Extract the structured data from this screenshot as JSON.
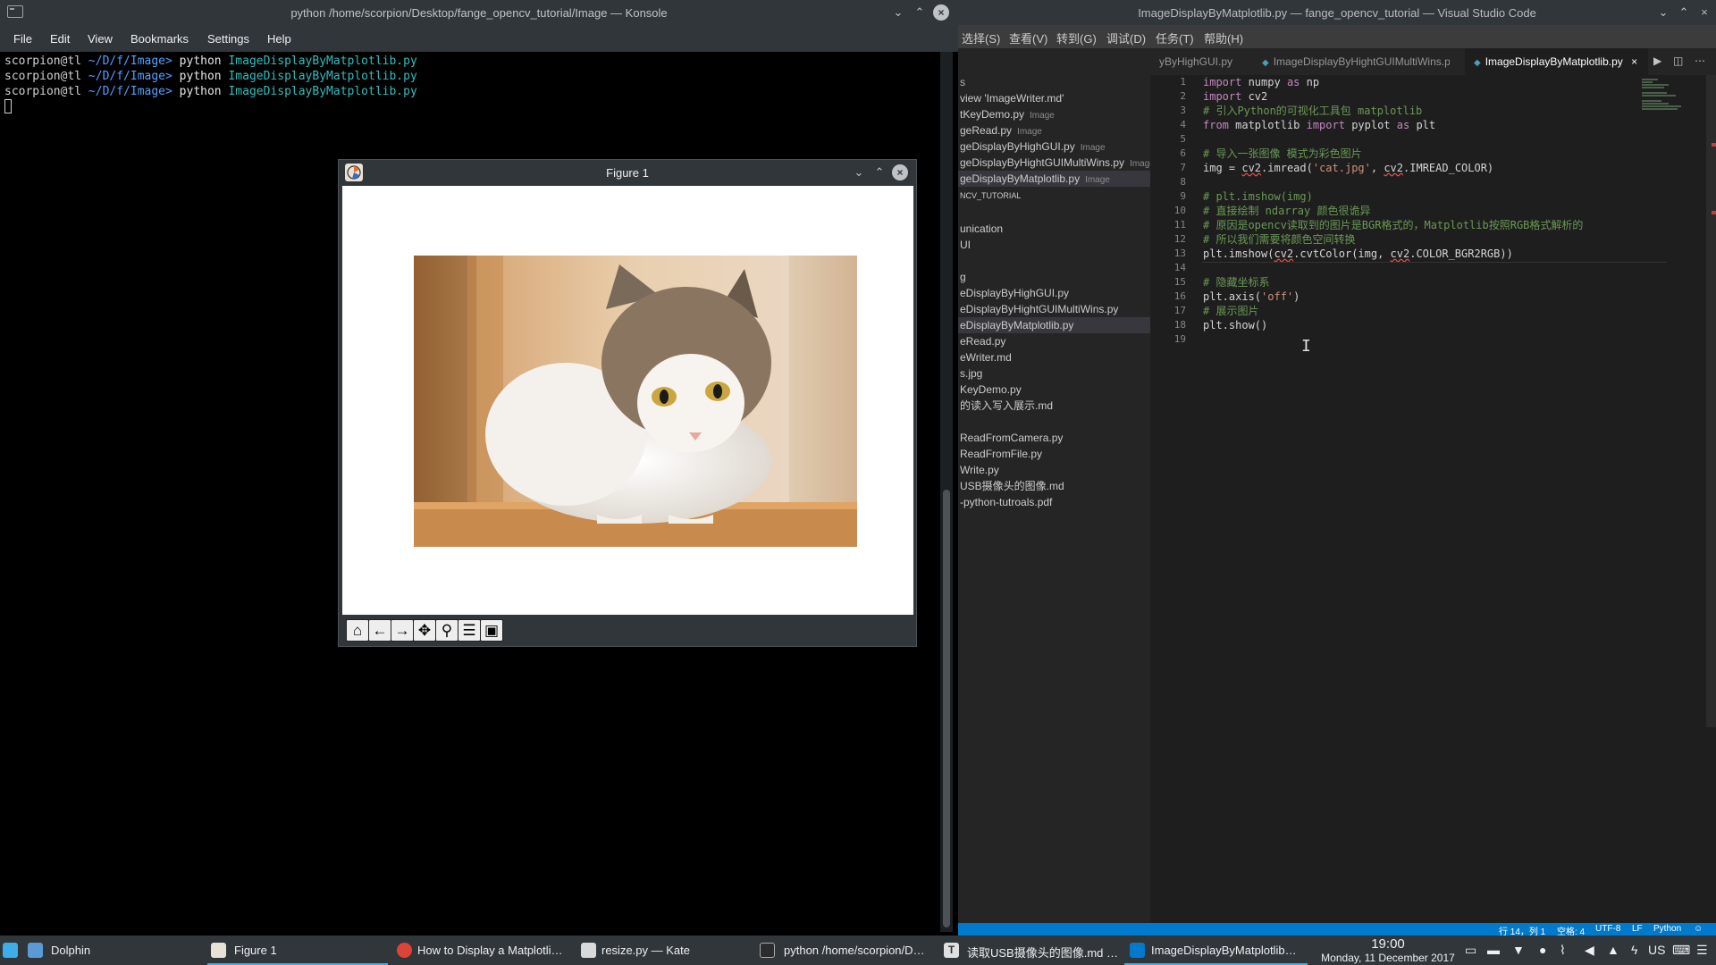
{
  "konsole": {
    "title": "python /home/scorpion/Desktop/fange_opencv_tutorial/Image — Konsole",
    "menu": [
      "File",
      "Edit",
      "View",
      "Bookmarks",
      "Settings",
      "Help"
    ],
    "lines": [
      {
        "user": "scorpion@tl",
        "path": " ~/D/f/Image>",
        "cmd": " python ",
        "arg": "ImageDisplayByMatplotlib.py"
      },
      {
        "user": "scorpion@tl",
        "path": " ~/D/f/Image>",
        "cmd": " python ",
        "arg": "ImageDisplayByMatplotlib.py"
      },
      {
        "user": "scorpion@tl",
        "path": " ~/D/f/Image>",
        "cmd": " python ",
        "arg": "ImageDisplayByMatplotlib.py"
      }
    ]
  },
  "vscode": {
    "title": "ImageDisplayByMatplotlib.py — fange_opencv_tutorial — Visual Studio Code",
    "menu": [
      "选择(S)",
      "查看(V)",
      "转到(G)",
      "调试(D)",
      "任务(T)",
      "帮助(H)"
    ],
    "tabs": [
      {
        "label": "yByHighGUI.py"
      },
      {
        "label": "ImageDisplayByHightGUIMultiWins.py"
      },
      {
        "label": "ImageDisplayByMatplotlib.py"
      }
    ],
    "tab_close": "×",
    "sidebar": {
      "section1": "S",
      "open_editors": [
        {
          "name": "view 'ImageWriter.md'",
          "dir": ""
        },
        {
          "name": "tKeyDemo.py",
          "dir": "Image"
        },
        {
          "name": "geRead.py",
          "dir": "Image"
        },
        {
          "name": "geDisplayByHighGUI.py",
          "dir": "Image"
        },
        {
          "name": "geDisplayByHightGUIMultiWins.py",
          "dir": "Image"
        },
        {
          "name": "geDisplayByMatplotlib.py",
          "dir": "Image"
        }
      ],
      "project_header": "NCV_TUTORIAL",
      "tree": [
        "unication",
        "UI",
        "",
        "g",
        "eDisplayByHighGUI.py",
        "eDisplayByHightGUIMultiWins.py",
        "eDisplayByMatplotlib.py",
        "eRead.py",
        "eWriter.md",
        "s.jpg",
        "KeyDemo.py",
        "的读入写入展示.md",
        "",
        "ReadFromCamera.py",
        "ReadFromFile.py",
        "Write.py",
        "USB摄像头的图像.md",
        "-python-tutroals.pdf"
      ]
    },
    "code_lines": [
      "1",
      "2",
      "3",
      "4",
      "5",
      "6",
      "7",
      "8",
      "9",
      "10",
      "11",
      "12",
      "13",
      "14",
      "15",
      "16",
      "17",
      "18",
      "19"
    ],
    "code": {
      "l1": [
        "import",
        " numpy ",
        "as",
        " np"
      ],
      "l2": [
        "import",
        " cv2"
      ],
      "l3": "# 引入Python的可视化工具包 matplotlib",
      "l4": [
        "from",
        " matplotlib ",
        "import",
        " pyplot ",
        "as",
        " plt"
      ],
      "l6": "# 导入一张图像 模式为彩色图片",
      "l7": [
        "img = ",
        "cv2",
        ".imread(",
        "'cat.jpg'",
        ", ",
        "cv2",
        ".IMREAD_COLOR)"
      ],
      "l9": "# plt.imshow(img)",
      "l10": "# 直接绘制 ndarray 颜色很诡异",
      "l11": "# 原因是opencv读取到的图片是BGR格式的，Matplotlib按照RGB格式解析的",
      "l12": "# 所以我们需要将颜色空间转换",
      "l13": [
        "plt.imshow(",
        "cv2",
        ".cvtColor(img, ",
        "cv2",
        ".COLOR_BGR2RGB))"
      ],
      "l15": "# 隐藏坐标系",
      "l16": [
        "plt.axis(",
        "'off'",
        ")"
      ],
      "l17": "# 展示图片",
      "l18": "plt.show()"
    },
    "status": {
      "position": "行 14，列 1",
      "spaces": "空格: 4",
      "encoding": "UTF-8",
      "eol": "LF",
      "language": "Python"
    }
  },
  "figure": {
    "title": "Figure 1",
    "toolbar": [
      "home",
      "back",
      "forward",
      "pan",
      "zoom",
      "configure",
      "save"
    ]
  },
  "taskbar": {
    "items": [
      {
        "label": "Dolphin"
      },
      {
        "label": "Figure 1"
      },
      {
        "label": "How to Display a Matplotli…"
      },
      {
        "label": "resize.py  — Kate"
      },
      {
        "label": "python  /home/scorpion/D…"
      },
      {
        "label": "读取USB摄像头的图像.md …"
      },
      {
        "label": "ImageDisplayByMatplotlib…"
      }
    ],
    "time": "19:00",
    "date": "Monday, 11 December 2017",
    "keyboard": "US"
  },
  "colors": {
    "accent": "#3daee9",
    "vscode_status": "#007acc",
    "comment": "#6a9955"
  }
}
